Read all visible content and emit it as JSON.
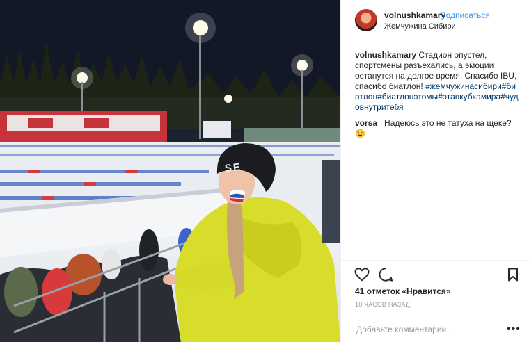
{
  "post": {
    "username": "volnushkamary",
    "separator": "•",
    "follow_label": "Подписаться",
    "location": "Жемчужина Сибири",
    "caption_text": "Стадион опустел, спортсмены разъехались, а эмоции останутся на долгое время. Спасибо IBU, спасибо биатлон!",
    "caption_tags": "#жемчужинасибири#биатлон#биатлонэтомы#этапкубкамира#чудовнутритебя",
    "comment_user": "vorsa_",
    "comment_text": "Надеюсь это не татуха на щеке?😉",
    "likes": "41 отметок «Нравится»",
    "time": "10 ЧАСОВ НАЗАД",
    "add_comment_placeholder": "Добавьте комментарий...",
    "more_label": "•••"
  },
  "photo": {
    "hat_text": "SE"
  },
  "icons": {
    "like": "heart-icon",
    "comment": "comment-bubble-icon",
    "save": "bookmark-icon",
    "more": "more-dots-icon"
  },
  "colors": {
    "follow": "#3897f0",
    "hashtag": "#003569",
    "text": "#262626",
    "muted": "#999999",
    "divider": "#efefef"
  }
}
